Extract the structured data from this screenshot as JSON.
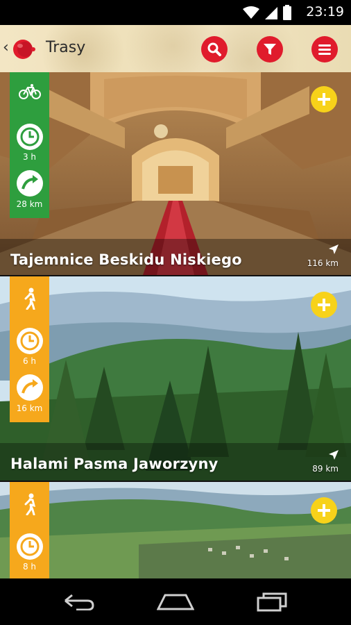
{
  "status": {
    "time": "23:19"
  },
  "appbar": {
    "title": "Trasy",
    "search_icon": "search-icon",
    "filter_icon": "filter-icon",
    "menu_icon": "menu-icon"
  },
  "routes": [
    {
      "name": "Tajemnice Beskidu Niskiego",
      "mode": "bike-icon",
      "duration": "3 h",
      "length": "28 km",
      "distance": "116 km",
      "mode_color": "#2e9e3e"
    },
    {
      "name": "Halami Pasma Jaworzyny",
      "mode": "hiking-icon",
      "duration": "6 h",
      "length": "16 km",
      "distance": "89 km",
      "mode_color": "#f6a81c"
    },
    {
      "name": "",
      "mode": "hiking-icon",
      "duration": "8 h",
      "length": "",
      "distance": "",
      "mode_color": "#f6a81c"
    }
  ],
  "colors": {
    "accent": "#e01b2c",
    "add": "#f7d21a"
  }
}
